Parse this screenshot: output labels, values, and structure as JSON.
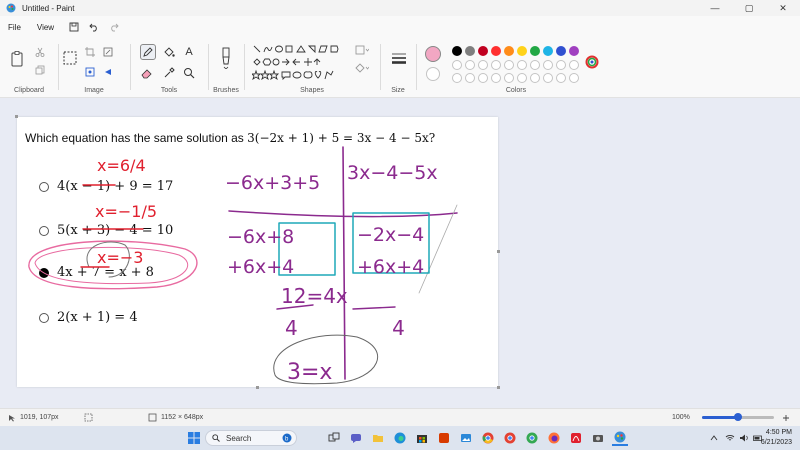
{
  "window": {
    "title": "Untitled - Paint",
    "controls": {
      "minimize": "—",
      "maximize": "▢",
      "close": "✕"
    }
  },
  "menu": {
    "file": "File",
    "view": "View"
  },
  "ribbon": {
    "groups": {
      "clipboard": "Clipboard",
      "image": "Image",
      "tools": "Tools",
      "brushes": "Brushes",
      "shapes": "Shapes",
      "size": "Size",
      "colors": "Colors"
    },
    "tools_text_glyph": "A",
    "primary_color": "#f2a7c3",
    "palette": [
      "#000000",
      "#7f7f7f",
      "#c00020",
      "#ff3030",
      "#ff8c1a",
      "#ffd21a",
      "#22a845",
      "#1fb4e6",
      "#3050d0",
      "#a040c0"
    ]
  },
  "question": {
    "lead": "Which equation has the same solution as ",
    "equation": "3(−2x + 1) + 5 = 3x − 4 − 5x?"
  },
  "options": [
    {
      "text": "4(x − 1) + 9 = 17",
      "selected": false
    },
    {
      "text": "5(x + 3) − 4 = 10",
      "selected": false
    },
    {
      "text": "4x + 7 = x + 8",
      "selected": true
    },
    {
      "text": "2(x + 1) = 4",
      "selected": false
    }
  ],
  "ink": {
    "red_notes": [
      "x=6/4",
      "x=−1/5",
      "x=−3"
    ],
    "purple_lines": [
      "−6x+3+5",
      "3x−4−5x",
      "−6x+8",
      "−2x−4",
      "+6x+4",
      "+6x+4",
      "12=4x",
      "4  4",
      "3=x"
    ],
    "colors": {
      "red": "#e0202e",
      "purple": "#8b2a8e",
      "teal": "#1fa8b8",
      "pink": "#e86aa0",
      "gray": "#666666"
    }
  },
  "status": {
    "cursor": "1019, 107px",
    "canvas_size": "1152 × 648px",
    "zoom_label": "100%",
    "zoom_value": 0.5
  },
  "taskbar": {
    "search_label": "Search",
    "time": "4:50 PM",
    "date": "6/21/2023"
  }
}
